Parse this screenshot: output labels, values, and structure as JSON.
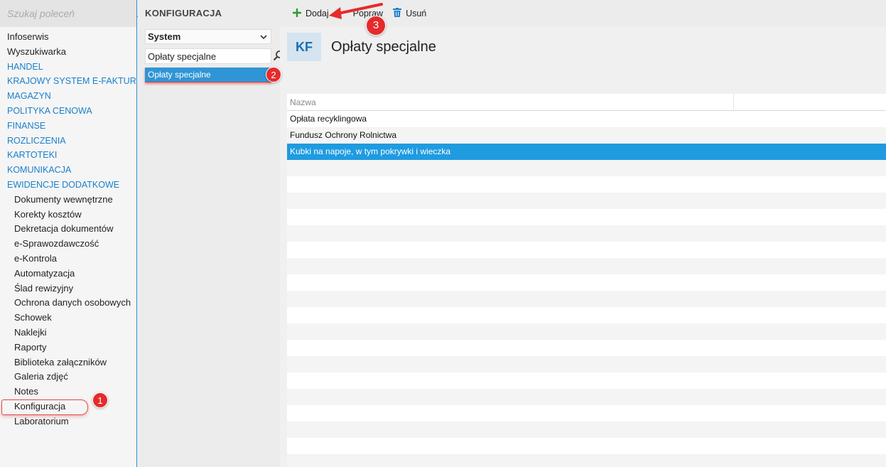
{
  "nav": {
    "search_placeholder": "Szukaj poleceń",
    "items": [
      {
        "label": "Infoserwis",
        "kind": "plain"
      },
      {
        "label": "Wyszukiwarka",
        "kind": "plain"
      },
      {
        "label": "HANDEL",
        "kind": "section"
      },
      {
        "label": "KRAJOWY SYSTEM E-FAKTUR",
        "kind": "section"
      },
      {
        "label": "MAGAZYN",
        "kind": "section"
      },
      {
        "label": "POLITYKA CENOWA",
        "kind": "section"
      },
      {
        "label": "FINANSE",
        "kind": "section"
      },
      {
        "label": "ROZLICZENIA",
        "kind": "section"
      },
      {
        "label": "KARTOTEKI",
        "kind": "section"
      },
      {
        "label": "KOMUNIKACJA",
        "kind": "section"
      },
      {
        "label": "EWIDENCJE DODATKOWE",
        "kind": "section"
      },
      {
        "label": "Dokumenty wewnętrzne",
        "kind": "sub"
      },
      {
        "label": "Korekty kosztów",
        "kind": "sub"
      },
      {
        "label": "Dekretacja dokumentów",
        "kind": "sub"
      },
      {
        "label": "e-Sprawozdawczość",
        "kind": "sub"
      },
      {
        "label": "e-Kontrola",
        "kind": "sub"
      },
      {
        "label": "Automatyzacja",
        "kind": "sub"
      },
      {
        "label": "Ślad rewizyjny",
        "kind": "sub"
      },
      {
        "label": "Ochrona danych osobowych",
        "kind": "sub"
      },
      {
        "label": "Schowek",
        "kind": "sub"
      },
      {
        "label": "Naklejki",
        "kind": "sub"
      },
      {
        "label": "Raporty",
        "kind": "sub"
      },
      {
        "label": "Biblioteka załączników",
        "kind": "sub"
      },
      {
        "label": "Galeria zdjęć",
        "kind": "sub"
      },
      {
        "label": "Notes",
        "kind": "sub"
      },
      {
        "label": "Konfiguracja",
        "kind": "sub",
        "selected": true
      },
      {
        "label": "Laboratorium",
        "kind": "sub"
      }
    ]
  },
  "mid": {
    "title": "KONFIGURACJA",
    "select_value": "System",
    "search_value": "Opłaty specjalne",
    "result_item": "Opłaty specjalne"
  },
  "toolbar": {
    "add_label": "Dodaj",
    "edit_label": "Popraw",
    "delete_label": "Usuń"
  },
  "header": {
    "badge": "KF",
    "title": "Opłaty specjalne"
  },
  "grid": {
    "column": "Nazwa",
    "rows": [
      "Opłata recyklingowa",
      "Fundusz Ochrony Rolnictwa",
      "Kubki na napoje, w tym pokrywki i wieczka"
    ],
    "selected_index": 2
  },
  "callouts": [
    "1",
    "2",
    "3"
  ],
  "colors": {
    "accent": "#1f9be0",
    "section_link": "#1a7fc9",
    "callout": "#e52b2b"
  }
}
